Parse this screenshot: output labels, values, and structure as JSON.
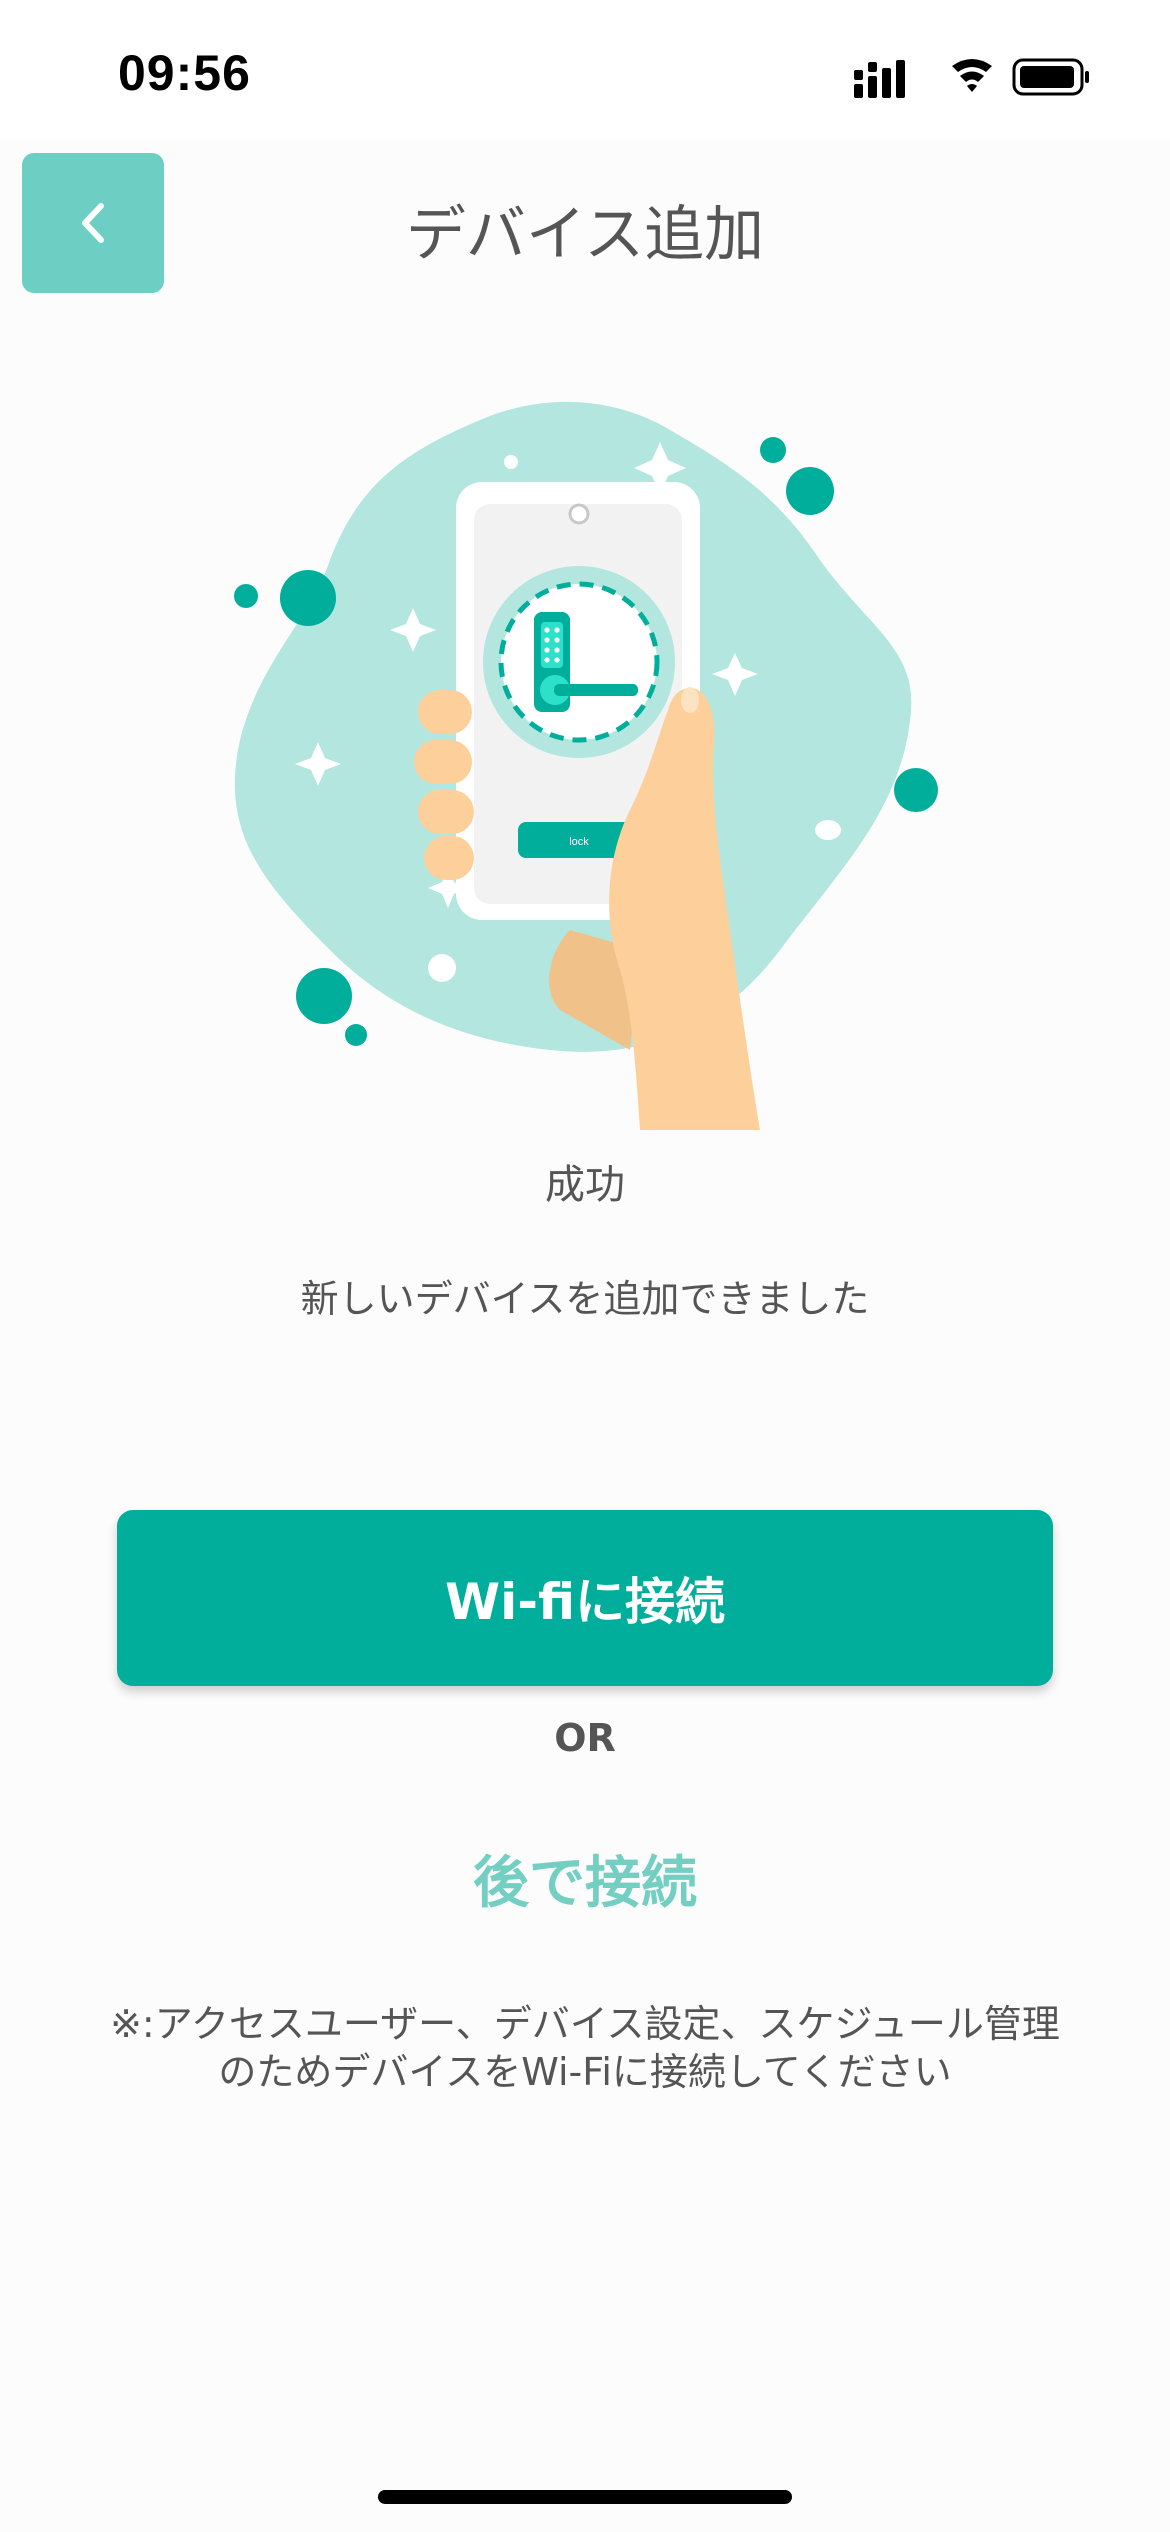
{
  "status_bar": {
    "time": "09:56",
    "icons": [
      "signal-icon",
      "wifi-icon",
      "battery-icon"
    ]
  },
  "header": {
    "back_icon": "chevron-left-icon",
    "title": "デバイス追加"
  },
  "illustration": {
    "name": "phone-with-smart-lock",
    "lock_button_label": "lock"
  },
  "result": {
    "title": "成功",
    "message": "新しいデバイスを追加できました"
  },
  "actions": {
    "connect_wifi_label": "Wi-fiに接続",
    "or_label": "OR",
    "connect_later_label": "後で接続"
  },
  "note": {
    "line1": "※:アクセスユーザー、デバイス設定、スケジュール管理",
    "line2": "のためデバイスをWi-Fiに接続してください"
  },
  "colors": {
    "primary": "#00ae9b",
    "back_button": "#6dcfc3",
    "link": "#74cfc3",
    "blob": "#b2e6df",
    "text": "#555555"
  }
}
